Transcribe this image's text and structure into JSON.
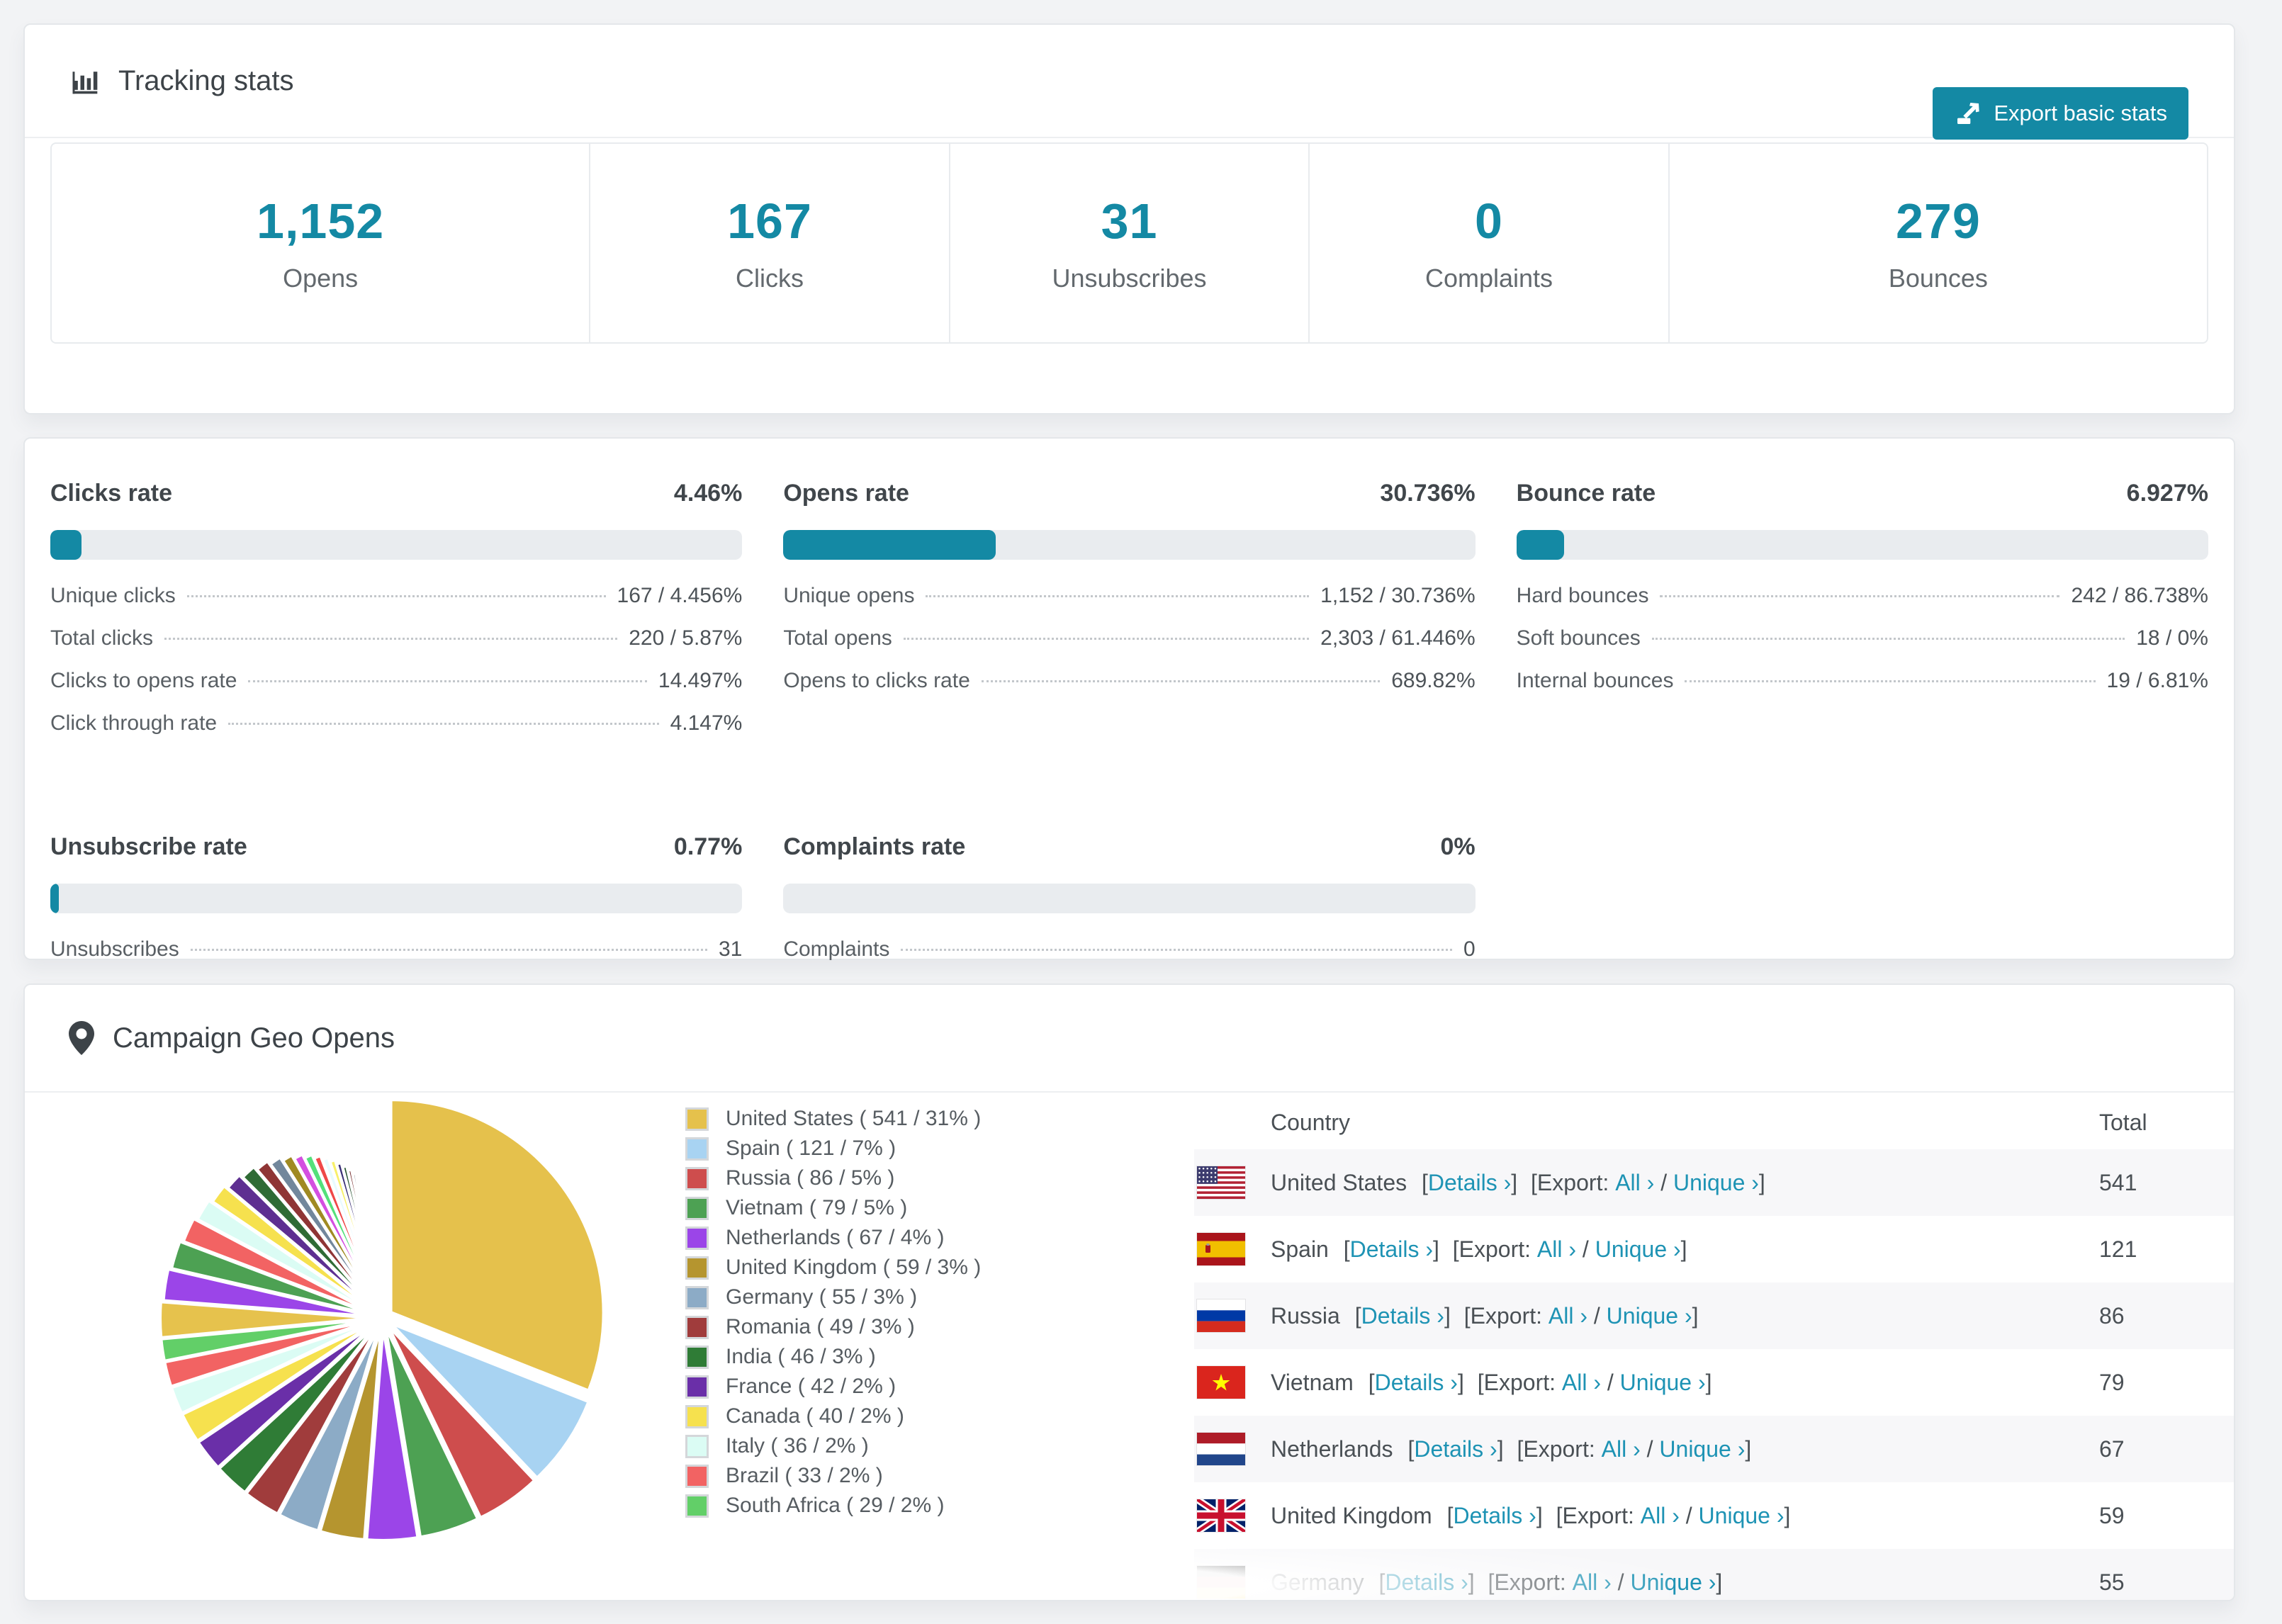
{
  "colors": {
    "accent": "#1489a4",
    "link": "#1e93b4",
    "bar_track": "#e9ecef",
    "stripe": "#f7f7f9",
    "page_bg": "#f2f3f5"
  },
  "tracking": {
    "title": "Tracking stats",
    "export_label": "Export basic stats",
    "stats": [
      {
        "value": "1,152",
        "label": "Opens"
      },
      {
        "value": "167",
        "label": "Clicks"
      },
      {
        "value": "31",
        "label": "Unsubscribes"
      },
      {
        "value": "0",
        "label": "Complaints"
      },
      {
        "value": "279",
        "label": "Bounces"
      }
    ]
  },
  "rates": [
    {
      "title": "Clicks rate",
      "value": "4.46%",
      "percent": 4.46,
      "rows": [
        {
          "label": "Unique clicks",
          "value": "167 / 4.456%"
        },
        {
          "label": "Total clicks",
          "value": "220 / 5.87%"
        },
        {
          "label": "Clicks to opens rate",
          "value": "14.497%"
        },
        {
          "label": "Click through rate",
          "value": "4.147%"
        }
      ]
    },
    {
      "title": "Opens rate",
      "value": "30.736%",
      "percent": 30.736,
      "rows": [
        {
          "label": "Unique opens",
          "value": "1,152 / 30.736%"
        },
        {
          "label": "Total opens",
          "value": "2,303 / 61.446%"
        },
        {
          "label": "Opens to clicks rate",
          "value": "689.82%"
        }
      ]
    },
    {
      "title": "Bounce rate",
      "value": "6.927%",
      "percent": 6.927,
      "rows": [
        {
          "label": "Hard bounces",
          "value": "242 / 86.738%"
        },
        {
          "label": "Soft bounces",
          "value": "18 / 0%"
        },
        {
          "label": "Internal bounces",
          "value": "19 / 6.81%"
        }
      ]
    },
    {
      "title": "Unsubscribe rate",
      "value": "0.77%",
      "percent": 0.77,
      "rows": [
        {
          "label": "Unsubscribes",
          "value": "31"
        }
      ]
    },
    {
      "title": "Complaints rate",
      "value": "0%",
      "percent": 0,
      "rows": [
        {
          "label": "Complaints",
          "value": "0"
        }
      ]
    }
  ],
  "geo": {
    "title": "Campaign Geo Opens",
    "chart_data": {
      "type": "pie",
      "title": "Campaign Geo Opens",
      "unit": "opens",
      "start_angle_deg": 0,
      "clockwise": true,
      "slices": [
        {
          "label": "United States",
          "value": 541,
          "pct": 31,
          "color": "#e5c14c"
        },
        {
          "label": "Spain",
          "value": 121,
          "pct": 7,
          "color": "#a8d3f2"
        },
        {
          "label": "Russia",
          "value": 86,
          "pct": 5,
          "color": "#ce4d4d"
        },
        {
          "label": "Vietnam",
          "value": 79,
          "pct": 5,
          "color": "#4da153"
        },
        {
          "label": "Netherlands",
          "value": 67,
          "pct": 4,
          "color": "#9b45e8"
        },
        {
          "label": "United Kingdom",
          "value": 59,
          "pct": 3,
          "color": "#b5952f"
        },
        {
          "label": "Germany",
          "value": 55,
          "pct": 3,
          "color": "#8cabc6"
        },
        {
          "label": "Romania",
          "value": 49,
          "pct": 3,
          "color": "#a03c3c"
        },
        {
          "label": "India",
          "value": 46,
          "pct": 3,
          "color": "#2f7c36"
        },
        {
          "label": "France",
          "value": 42,
          "pct": 2,
          "color": "#6a2fa8"
        },
        {
          "label": "Canada",
          "value": 40,
          "pct": 2,
          "color": "#f6e14e"
        },
        {
          "label": "Italy",
          "value": 36,
          "pct": 2,
          "color": "#dbfcf4"
        },
        {
          "label": "Brazil",
          "value": 33,
          "pct": 2,
          "color": "#f26363"
        },
        {
          "label": "South Africa",
          "value": 29,
          "pct": 2,
          "color": "#62cf68"
        }
      ],
      "tail": {
        "est_total": 462,
        "slice_count": 42,
        "note": "long tail of small unlabeled country slices",
        "colors": [
          "#e6c24d",
          "#9b45e8",
          "#4da153",
          "#f26363",
          "#dbfcf4",
          "#f6e14e",
          "#5e2f91",
          "#2f6b35",
          "#8f3535",
          "#72879c",
          "#a08a22",
          "#d44fe0",
          "#54e07a",
          "#ef4848",
          "#e8fbff",
          "#f8f06a",
          "#3a2f75",
          "#1f4d2a",
          "#6e2222",
          "#5a6671",
          "#8d7c1e",
          "#e060e0",
          "#40e060",
          "#e04040",
          "#aee1f8",
          "#c95656",
          "#3fae4e",
          "#8e5fe8",
          "#d8b53a",
          "#f58fb1",
          "#7de8d8",
          "#b0b0e8"
        ]
      }
    },
    "table": {
      "headers": {
        "country": "Country",
        "total": "Total"
      },
      "links": {
        "bracket_open": "[",
        "bracket_close": "]",
        "details": "Details ›",
        "export_prefix": "Export:",
        "all": "All ›",
        "slash": "/",
        "unique": "Unique ›"
      },
      "rows": [
        {
          "country": "United States",
          "total": "541",
          "flag": "us"
        },
        {
          "country": "Spain",
          "total": "121",
          "flag": "es"
        },
        {
          "country": "Russia",
          "total": "86",
          "flag": "ru"
        },
        {
          "country": "Vietnam",
          "total": "79",
          "flag": "vn"
        },
        {
          "country": "Netherlands",
          "total": "67",
          "flag": "nl"
        },
        {
          "country": "United Kingdom",
          "total": "59",
          "flag": "gb"
        },
        {
          "country": "Germany",
          "total": "55",
          "flag": "de"
        }
      ]
    }
  }
}
